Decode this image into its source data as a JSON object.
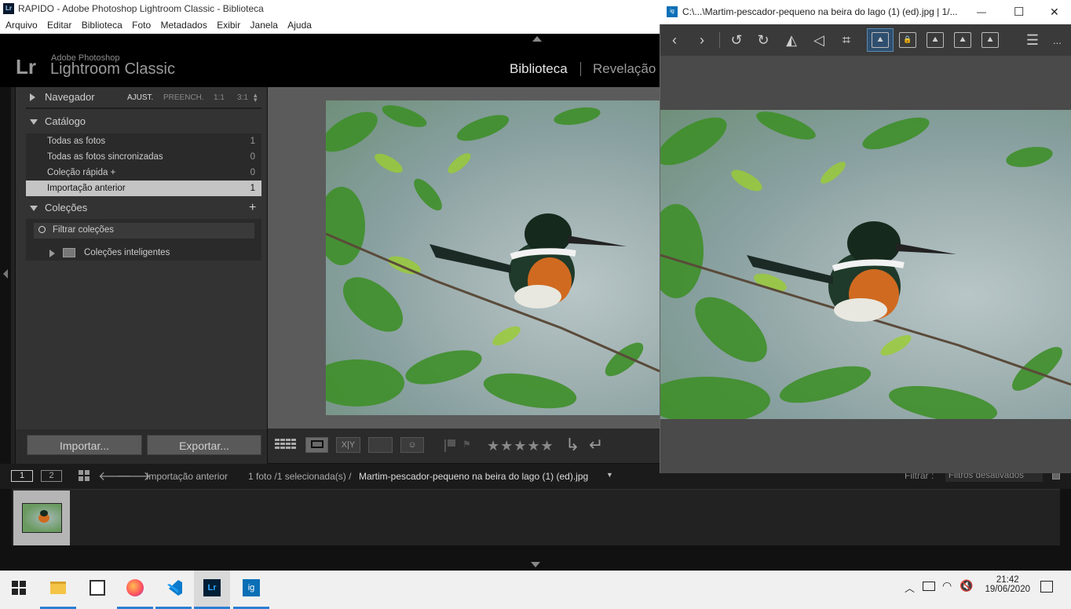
{
  "window": {
    "app_badge": "Lr",
    "title": "RAPIDO - Adobe Photoshop Lightroom Classic - Biblioteca"
  },
  "menu": [
    "Arquivo",
    "Editar",
    "Biblioteca",
    "Foto",
    "Metadados",
    "Exibir",
    "Janela",
    "Ajuda"
  ],
  "identity": {
    "logo": "Lr",
    "brand_line1": "Adobe Photoshop",
    "brand_line2": "Lightroom Classic",
    "modules": [
      "Biblioteca",
      "Revelação"
    ]
  },
  "navigator": {
    "title": "Navegador",
    "zoom_options": [
      "AJUST.",
      "PREENCH.",
      "1:1",
      "3:1"
    ]
  },
  "catalog": {
    "title": "Catálogo",
    "rows": [
      {
        "label": "Todas as fotos",
        "count": "1"
      },
      {
        "label": "Todas as fotos sincronizadas",
        "count": "0"
      },
      {
        "label": "Coleção rápida  +",
        "count": "0"
      },
      {
        "label": "Importação anterior",
        "count": "1"
      }
    ]
  },
  "collections": {
    "title": "Coleções",
    "add": "+",
    "filter_placeholder": "Filtrar coleções",
    "smart": "Coleções inteligentes"
  },
  "buttons": {
    "import": "Importar...",
    "export": "Exportar..."
  },
  "toolbar": {
    "compare": "X|Y",
    "stars": "★★★★★"
  },
  "filmstrip": {
    "screen1": "1",
    "screen2": "2",
    "source": "Importação anterior",
    "status": "1 foto /1 selecionada(s) /",
    "filename": "Martim-pescador-pequeno na beira do lago (1) (ed).jpg",
    "filter_label": "Filtrar :",
    "filter_value": "Filtros desativados"
  },
  "viewer": {
    "title": "C:\\...\\Martim-pescador-pequeno na beira do lago (1) (ed).jpg  |  1/...",
    "minimize": "—",
    "maximize": "☐",
    "close": "✕",
    "more": "..."
  },
  "taskbar": {
    "time": "21:42",
    "date": "19/06/2020",
    "apps": [
      "file-explorer",
      "calendar",
      "firefox",
      "vscode",
      "lightroom",
      "image-viewer"
    ],
    "lr_label": "Lr",
    "ig_label": "ig"
  },
  "colors": {
    "lr_bg": "#111111",
    "panel": "#333333",
    "selection": "#c4c4c4",
    "taskbar": "#f0f0f0",
    "accent": "#2b7fd4"
  }
}
